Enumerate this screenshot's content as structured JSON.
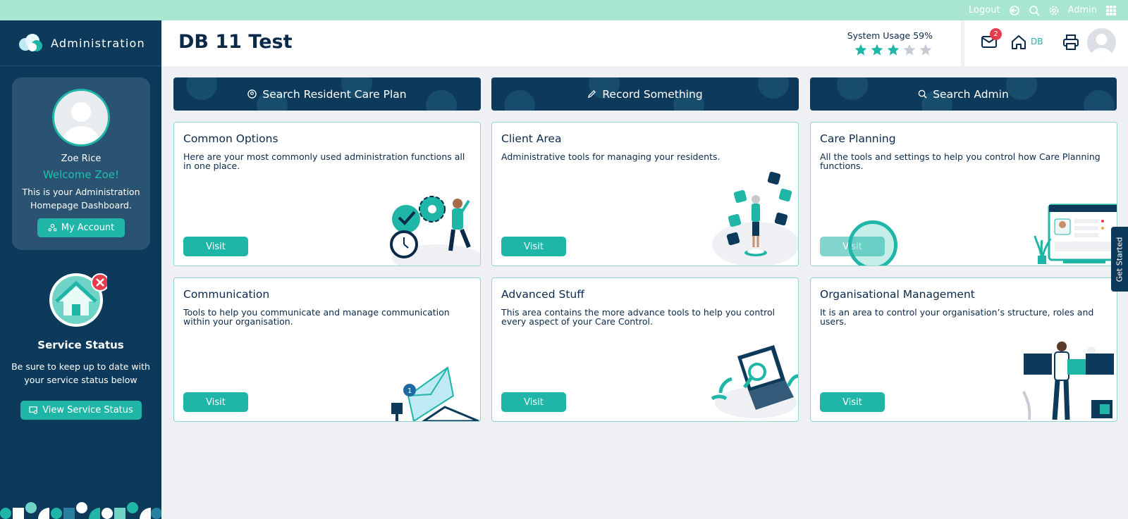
{
  "topbar": {
    "logout_label": "Logout",
    "user_label": "Admin",
    "icons": [
      "logout-icon",
      "search-icon",
      "gear-icon",
      "apps-grid-icon"
    ]
  },
  "sidebar": {
    "brand": "Administration",
    "profile": {
      "name": "Zoe Rice",
      "welcome": "Welcome Zoe!",
      "description": "This is your Administration Homepage Dashboard.",
      "account_button": "My Account"
    },
    "service": {
      "title": "Service Status",
      "description": "Be sure to keep up to date with your service status below",
      "button": "View Service Status"
    }
  },
  "header": {
    "title": "DB 11 Test",
    "usage_label": "System Usage 59%",
    "usage_percent": 59,
    "stars_filled": 3,
    "stars_total": 5,
    "mail_badge": "2",
    "home_label": "DB"
  },
  "actions": [
    {
      "label": "Search Resident Care Plan",
      "icon": "person-circle-icon"
    },
    {
      "label": "Record Something",
      "icon": "pencil-icon"
    },
    {
      "label": "Search Admin",
      "icon": "search-icon"
    }
  ],
  "cards": [
    {
      "title": "Common Options",
      "description": "Here are your most commonly used administration functions all in one place.",
      "button": "Visit"
    },
    {
      "title": "Client Area",
      "description": "Administrative tools for managing your residents.",
      "button": "Visit"
    },
    {
      "title": "Care Planning",
      "description": "All the tools and settings to help you control how Care Planning functions.",
      "button": "Visit"
    },
    {
      "title": "Communication",
      "description": "Tools to help you communicate and manage communication within your organisation.",
      "button": "Visit"
    },
    {
      "title": "Advanced Stuff",
      "description": "This area contains the more advance tools to help you control every aspect of your Care Control.",
      "button": "Visit"
    },
    {
      "title": "Organisational Management",
      "description": "It is an area to control your organisation’s structure, roles and users.",
      "button": "Visit"
    }
  ],
  "get_started": "Get Started",
  "colors": {
    "navy": "#0d3a5a",
    "teal": "#1fb6a8",
    "mint_bar": "#a8e6d0",
    "badge_red": "#e73c4e",
    "star_empty": "#c7ccd4"
  }
}
